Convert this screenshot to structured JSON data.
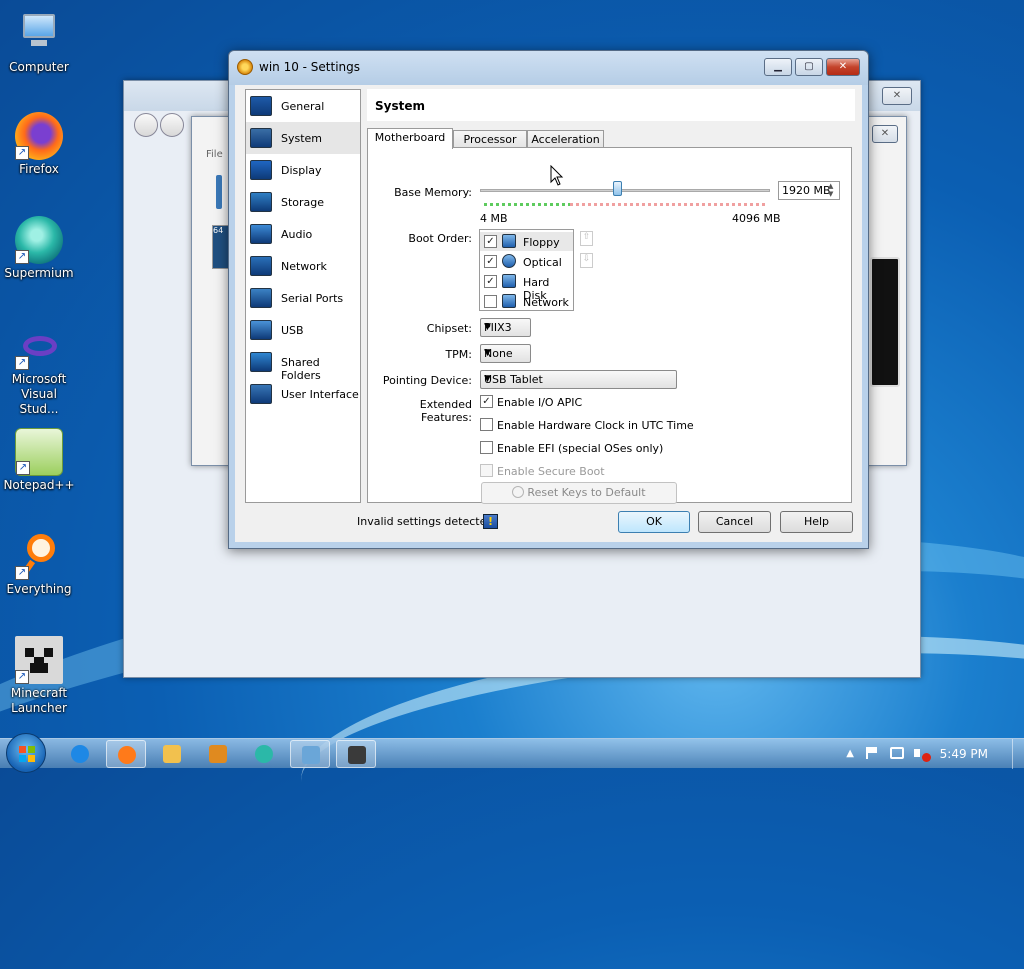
{
  "desktop": {
    "icons": [
      {
        "label": "Computer",
        "name": "computer-icon"
      },
      {
        "label": "Firefox",
        "name": "firefox-icon"
      },
      {
        "label": "Supermium",
        "name": "supermium-icon"
      },
      {
        "label": "Microsoft Visual Stud...",
        "name": "visual-studio-icon"
      },
      {
        "label": "Notepad++",
        "name": "notepad-plus-plus-icon"
      },
      {
        "label": "Everything",
        "name": "everything-icon"
      },
      {
        "label": "Minecraft Launcher",
        "name": "minecraft-launcher-icon"
      }
    ]
  },
  "background_window": {
    "menu_file": "File",
    "tag_64": "64",
    "close_glyph": "✕"
  },
  "dialog": {
    "title": "win 10 - Settings",
    "min_glyph": "▁",
    "max_glyph": "▢",
    "close_glyph": "✕",
    "sidebar": [
      {
        "label": "General",
        "icon": "monitor-icon",
        "color": "#1e5aa8"
      },
      {
        "label": "System",
        "icon": "chip-icon",
        "color": "#3a6ea5"
      },
      {
        "label": "Display",
        "icon": "display-icon",
        "color": "#1f66c2"
      },
      {
        "label": "Storage",
        "icon": "disk-icon",
        "color": "#2f7fc4"
      },
      {
        "label": "Audio",
        "icon": "speaker-icon",
        "color": "#3c8ad6"
      },
      {
        "label": "Network",
        "icon": "network-icon",
        "color": "#2a6fb8"
      },
      {
        "label": "Serial Ports",
        "icon": "serial-port-icon",
        "color": "#3b82c4"
      },
      {
        "label": "USB",
        "icon": "usb-icon",
        "color": "#4a93d8"
      },
      {
        "label": "Shared Folders",
        "icon": "folder-icon",
        "color": "#2f86d2"
      },
      {
        "label": "User Interface",
        "icon": "window-icon",
        "color": "#3876b6"
      }
    ],
    "header": "System",
    "tabs": [
      "Motherboard",
      "Processor",
      "Acceleration"
    ],
    "base_memory": {
      "label": "Base Memory:",
      "value": "1920 MB",
      "value_mb": 1920,
      "min": "4 MB",
      "max": "4096 MB",
      "min_mb": 4,
      "max_mb": 4096
    },
    "boot_order": {
      "label": "Boot Order:",
      "items": [
        {
          "label": "Floppy",
          "checked": true,
          "icon": "floppy-icon"
        },
        {
          "label": "Optical",
          "checked": true,
          "icon": "optical-disc-icon"
        },
        {
          "label": "Hard Disk",
          "checked": true,
          "icon": "hard-disk-icon"
        },
        {
          "label": "Network",
          "checked": false,
          "icon": "network-boot-icon"
        }
      ]
    },
    "chipset": {
      "label": "Chipset:",
      "value": "PIIX3"
    },
    "tpm": {
      "label": "TPM:",
      "value": "None"
    },
    "pointing": {
      "label": "Pointing Device:",
      "value": "USB Tablet"
    },
    "extended": {
      "label": "Extended Features:",
      "items": [
        {
          "label": "Enable I/O APIC",
          "checked": true,
          "disabled": false
        },
        {
          "label": "Enable Hardware Clock in UTC Time",
          "checked": false,
          "disabled": false
        },
        {
          "label": "Enable EFI (special OSes only)",
          "checked": false,
          "disabled": false
        },
        {
          "label": "Enable Secure Boot",
          "checked": false,
          "disabled": true
        }
      ]
    },
    "reset_keys": "Reset Keys to Default",
    "invalid_settings": "Invalid settings detected",
    "ok": "OK",
    "cancel": "Cancel",
    "help": "Help"
  },
  "taskbar": {
    "clock": "5:49 PM",
    "items": [
      "ie-icon",
      "firefox-icon",
      "explorer-icon",
      "media-player-icon",
      "supermium-icon",
      "control-panel-icon",
      "virtualbox-icon"
    ]
  }
}
